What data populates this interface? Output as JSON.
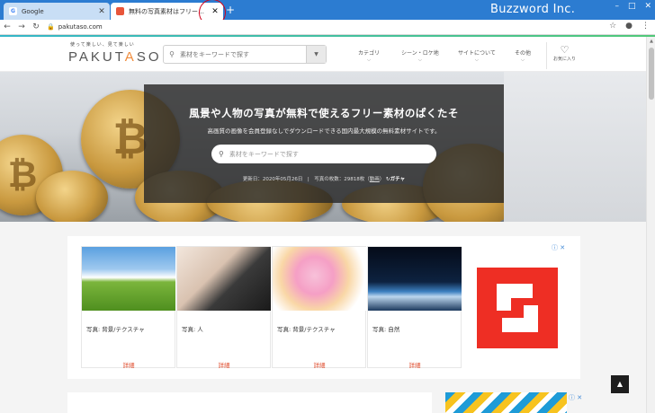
{
  "browser": {
    "tabs": [
      {
        "title": "Google",
        "favicon": "G"
      },
      {
        "title": "無料の写真素材はフリー素材のぱくたそ"
      }
    ],
    "close_glyph": "✕",
    "new_tab_glyph": "+",
    "brand": "Buzzword Inc.",
    "url": "pakutaso.com",
    "window_controls": [
      "–",
      "□",
      "✕"
    ]
  },
  "site": {
    "tagline": "使って楽しい、見て楽しい",
    "logo": {
      "a": "PAKUT",
      "b": "A",
      "c": "SO"
    },
    "search_placeholder": "素材をキーワードで探す",
    "nav": [
      {
        "label": "カテゴリ"
      },
      {
        "label": "シーン・ロケ地"
      },
      {
        "label": "サイトについて"
      },
      {
        "label": "その他"
      }
    ],
    "favorites_label": "お気に入り"
  },
  "hero": {
    "title": "風景や人物の写真が無料で使えるフリー素材のぱくたそ",
    "subtitle": "高画質の画像を会員登録なしでダウンロードできる国内最大規模の無料素材サイトです。",
    "search_placeholder": "素材をキーワードで探す",
    "meta": "更新日：2020年05月26日　|　写真の枚数：29818枚（",
    "meta_link": "動画",
    "meta_after": "）",
    "gacha": "ガチャ"
  },
  "ads": {
    "cards": [
      {
        "caption": "写真: 背景/テクスチャ",
        "more": "詳細"
      },
      {
        "caption": "写真: 人",
        "more": "詳細"
      },
      {
        "caption": "写真: 背景/テクスチャ",
        "more": "詳細"
      },
      {
        "caption": "写真: 自然",
        "more": "詳細"
      }
    ],
    "info_glyph": "ⓘ ✕"
  },
  "colors": {
    "titlebar": "#2c7cd1",
    "accent": "#e04b2c",
    "shutterstock": "#ee2e24"
  }
}
